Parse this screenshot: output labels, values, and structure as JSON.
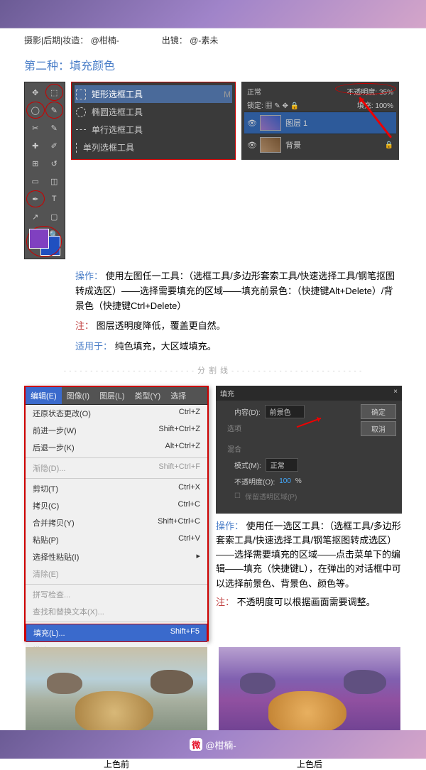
{
  "credit": {
    "line1_label": "摄影|后期|妆造：",
    "line1_handle": "@柑楠-",
    "line2_label": "出镜：",
    "line2_handle": "@-素未"
  },
  "section_title": "第二种：填充颜色",
  "marquee_tools": {
    "rect": "矩形选框工具",
    "ellipse": "椭圆选框工具",
    "row": "单行选框工具",
    "col": "单列选框工具",
    "key": "M"
  },
  "layers": {
    "mode": "正常",
    "opacity_label": "不透明度:",
    "opacity_value": "35%",
    "lock_label": "锁定:",
    "fill_label": "填充:",
    "fill_value": "100%",
    "layer1": "图层 1",
    "background": "背景"
  },
  "instr1": {
    "op_label": "操作：",
    "op_text": "使用左图任一工具：（选框工具/多边形套索工具/快速选择工具/钢笔抠图转成选区）——选择需要填充的区域——填充前景色：（快捷键Alt+Delete）/背景色（快捷键Ctrl+Delete）",
    "note_label": "注：",
    "note_text": "图层透明度降低，覆盖更自然。",
    "apply_label": "适用于：",
    "apply_text": "纯色填充，大区域填充。"
  },
  "divider": "分 割 线",
  "menubar": {
    "edit": "编辑(E)",
    "image": "图像(I)",
    "layer": "图层(L)",
    "type": "类型(Y)",
    "select": "选择"
  },
  "menu_items": {
    "undo": {
      "t": "还原状态更改(O)",
      "k": "Ctrl+Z"
    },
    "step_forward": {
      "t": "前进一步(W)",
      "k": "Shift+Ctrl+Z"
    },
    "step_back": {
      "t": "后退一步(K)",
      "k": "Alt+Ctrl+Z"
    },
    "fade": {
      "t": "渐隐(D)...",
      "k": "Shift+Ctrl+F"
    },
    "cut": {
      "t": "剪切(T)",
      "k": "Ctrl+X"
    },
    "copy": {
      "t": "拷贝(C)",
      "k": "Ctrl+C"
    },
    "copy_merged": {
      "t": "合并拷贝(Y)",
      "k": "Shift+Ctrl+C"
    },
    "paste": {
      "t": "粘贴(P)",
      "k": "Ctrl+V"
    },
    "paste_special": {
      "t": "选择性粘贴(I)",
      "k": ""
    },
    "clear": {
      "t": "清除(E)",
      "k": ""
    },
    "spell": {
      "t": "拼写检查...",
      "k": ""
    },
    "find_replace": {
      "t": "查找和替换文本(X)...",
      "k": ""
    },
    "fill": {
      "t": "填充(L)...",
      "k": "Shift+F5"
    },
    "stroke": {
      "t": "描边(S)...",
      "k": ""
    }
  },
  "fill_dialog": {
    "title": "填充",
    "close": "×",
    "content_label": "内容(D):",
    "content_value": "前景色",
    "ok": "确定",
    "cancel": "取消",
    "options": "选项",
    "blend": "混合",
    "mode_label": "模式(M):",
    "mode_value": "正常",
    "opacity_label": "不透明度(O):",
    "opacity_value": "100",
    "opacity_unit": "%",
    "preserve": "保留透明区域(P)"
  },
  "instr2": {
    "op_label": "操作：",
    "op_text": "使用任一选区工具：（选框工具/多边形套索工具/快速选择工具/钢笔抠图转成选区）——选择需要填充的区域——点击菜单下的编辑——填充（快捷键L），在弹出的对话框中可以选择前景色、背景色、颜色等。",
    "note_label": "注：",
    "note_text": "不透明度可以根据画面需要调整。"
  },
  "compare": {
    "before": "上色前",
    "after": "上色后"
  },
  "footer_handle": "@柑楠-"
}
